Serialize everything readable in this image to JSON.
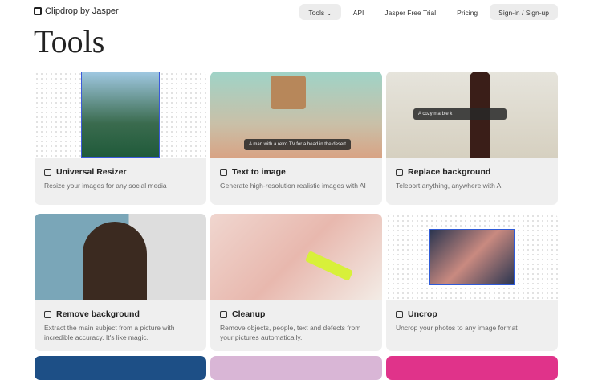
{
  "header": {
    "logo": "Clipdrop by Jasper",
    "nav": [
      "Tools",
      "API",
      "Jasper Free Trial",
      "Pricing",
      "Sign-in / Sign-up"
    ]
  },
  "page_title": "Tools",
  "tools": [
    {
      "title": "Universal Resizer",
      "desc": "Resize your images for any social media",
      "icon": "resize-icon"
    },
    {
      "title": "Text to image",
      "desc": "Generate high-resolution realistic images with AI",
      "icon": "text-image-icon",
      "caption": "A man with a retro TV for a head in the desert"
    },
    {
      "title": "Replace background",
      "desc": "Teleport anything, anywhere with AI",
      "icon": "replace-bg-icon",
      "caption": "A cozy marble k"
    },
    {
      "title": "Remove background",
      "desc": "Extract the main subject from a picture with incredible accuracy. It's like magic.",
      "icon": "remove-bg-icon"
    },
    {
      "title": "Cleanup",
      "desc": "Remove objects, people, text and defects from your pictures automatically.",
      "icon": "eraser-icon"
    },
    {
      "title": "Uncrop",
      "desc": "Uncrop your photos to any image format",
      "icon": "uncrop-icon"
    }
  ]
}
